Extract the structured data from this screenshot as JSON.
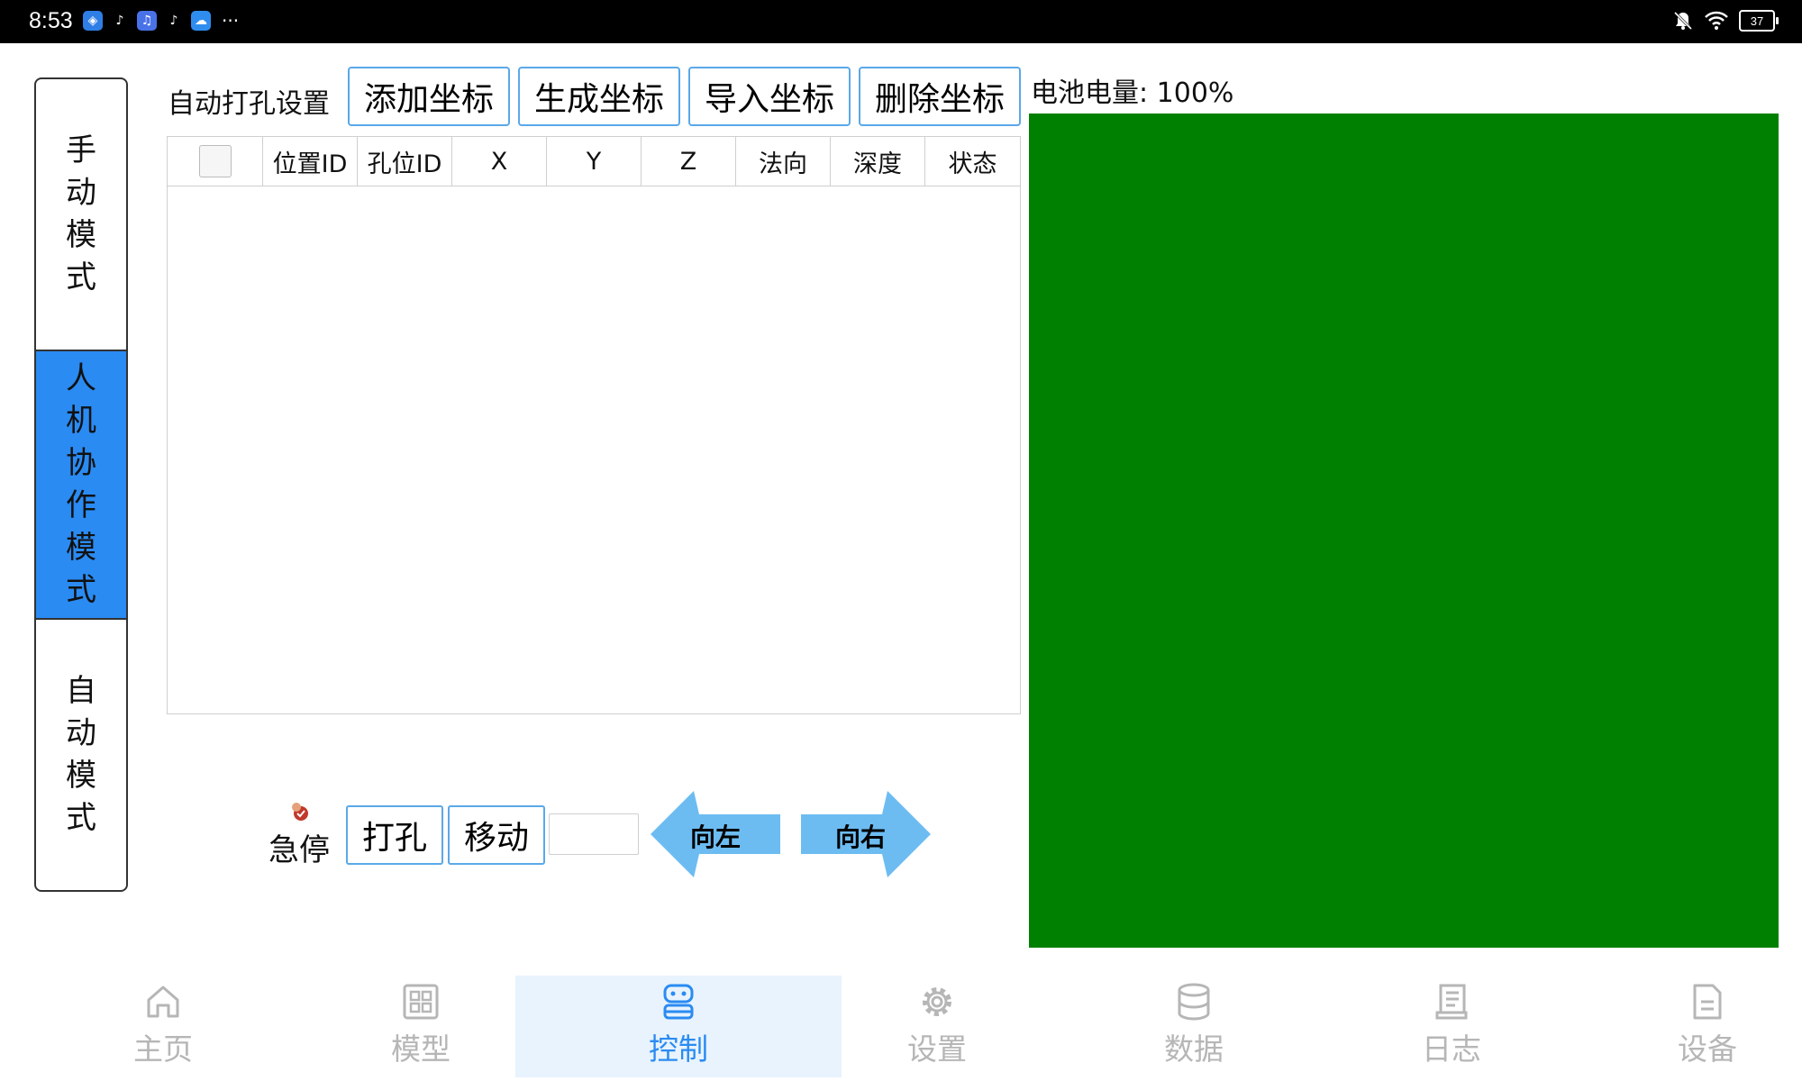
{
  "status_bar": {
    "time": "8:53",
    "battery": "37",
    "more": "···"
  },
  "modes": [
    {
      "label": "手动模式",
      "active": false
    },
    {
      "label": "人机协作模式",
      "active": true
    },
    {
      "label": "自动模式",
      "active": false
    }
  ],
  "toolbar": {
    "title": "自动打孔设置",
    "add": "添加坐标",
    "generate": "生成坐标",
    "import": "导入坐标",
    "delete": "删除坐标"
  },
  "battery_label": "电池电量:  100%",
  "table": {
    "columns": [
      "位置ID",
      "孔位ID",
      "X",
      "Y",
      "Z",
      "法向",
      "深度",
      "状态"
    ],
    "rows": []
  },
  "controls": {
    "estop": "急停",
    "drill": "打孔",
    "move": "移动",
    "input_value": "",
    "left": "向左",
    "right": "向右"
  },
  "colors": {
    "accent": "#2a8bf2",
    "panel": "#008000",
    "arrow": "#6cbcf2"
  },
  "nav": [
    {
      "label": "主页",
      "icon": "home-icon"
    },
    {
      "label": "模型",
      "icon": "grid-icon"
    },
    {
      "label": "控制",
      "icon": "robot-icon",
      "active": true
    },
    {
      "label": "设置",
      "icon": "gear-icon"
    },
    {
      "label": "数据",
      "icon": "database-icon"
    },
    {
      "label": "日志",
      "icon": "log-icon"
    },
    {
      "label": "设备",
      "icon": "document-icon"
    }
  ]
}
